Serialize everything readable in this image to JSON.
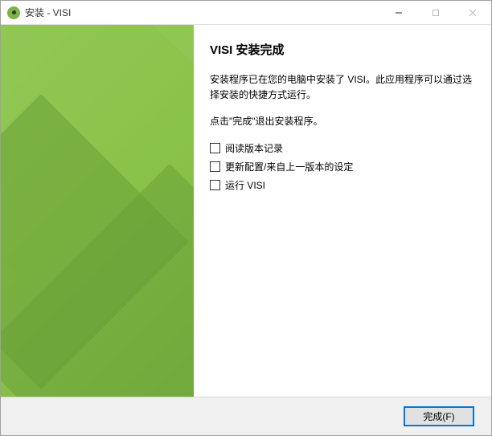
{
  "titlebar": {
    "title": "安装 - VISI"
  },
  "main": {
    "heading": "VISI 安装完成",
    "paragraph1": "安装程序已在您的电脑中安装了 VISI。此应用程序可以通过选择安装的快捷方式运行。",
    "paragraph2": "点击\"完成\"退出安装程序。",
    "checkbox1_label": "阅读版本记录",
    "checkbox2_label": "更新配置/来自上一版本的设定",
    "checkbox3_label": "运行 VISI"
  },
  "footer": {
    "finish_label": "完成(F)"
  }
}
